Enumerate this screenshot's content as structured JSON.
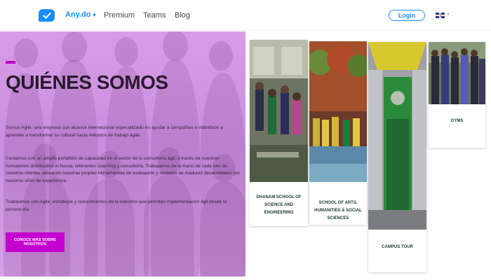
{
  "header": {
    "brand": "Any.do",
    "nav": [
      "Premium",
      "Teams",
      "Blog"
    ],
    "login": "Login"
  },
  "hero": {
    "title": "QUIÉNES SOMOS",
    "paragraphs": [
      "Somos Agile, una empresa con alcance internacional especializado en ayudar a compañías e individuos a aprender a transformar su cultural hacia métodos de trabajo ágile.",
      "Contamos con un amplio portafolio de capacidad en el sector de la consultoría ágil, a través de nuestros formadores distribuidos in house, referentes coaching y consultoría. Trabajamos de la mano de cada uno de nuestros clientes utilizando nuestras propias herramientas de evaluación y modelos de madurez desarrollados por nuestros años de experiencia.",
      "Trabajamos con Agile, estrategia y conocimientos de la industria que permiten implementación ágil desde la primera día"
    ],
    "cta": "CONOCE MÁS SOBRE NOSOTROS"
  },
  "cards": [
    {
      "label": "DHANAM SCHOOL OF SCIENCE AND ENGINEERING"
    },
    {
      "label": "SCHOOL OF ARTS, HUMANITIES & SOCIAL SCIENCES"
    },
    {
      "label": "CAMPUS TOUR"
    },
    {
      "label": "GYMS"
    }
  ],
  "colors": {
    "brand": "#1a8cff",
    "hero_overlay": "#d89ce6",
    "accent": "#c400d0"
  }
}
